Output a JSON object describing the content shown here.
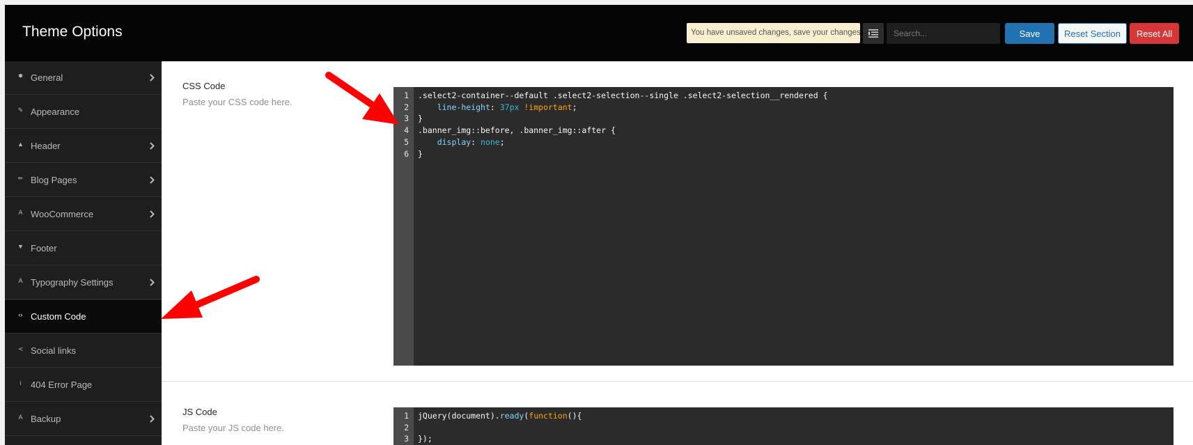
{
  "header": {
    "title": "Theme Options",
    "notice": "You have unsaved changes, save your changes!",
    "search_placeholder": "Search...",
    "save_label": "Save",
    "reset_section_label": "Reset Section",
    "reset_all_label": "Reset All",
    "list_icon": "list-icon"
  },
  "sidebar": {
    "items": [
      {
        "label": "General",
        "icon": "gear-icon",
        "glyph": "✹",
        "has_chevron": true,
        "active": false
      },
      {
        "label": "Appearance",
        "icon": "brush-icon",
        "glyph": "✎",
        "has_chevron": false,
        "active": false
      },
      {
        "label": "Header",
        "icon": "caret-up-icon",
        "glyph": "▲",
        "has_chevron": true,
        "active": false
      },
      {
        "label": "Blog Pages",
        "icon": "pin-icon",
        "glyph": "✏",
        "has_chevron": true,
        "active": false
      },
      {
        "label": "WooCommerce",
        "icon": "font-icon",
        "glyph": "A",
        "has_chevron": true,
        "active": false
      },
      {
        "label": "Footer",
        "icon": "caret-down-icon",
        "glyph": "▼",
        "has_chevron": false,
        "active": false
      },
      {
        "label": "Typography Settings",
        "icon": "font-icon",
        "glyph": "A",
        "has_chevron": true,
        "active": false
      },
      {
        "label": "Custom Code",
        "icon": "code-icon",
        "glyph": "‹›",
        "has_chevron": false,
        "active": true
      },
      {
        "label": "Social links",
        "icon": "share-icon",
        "glyph": "≺",
        "has_chevron": false,
        "active": false
      },
      {
        "label": "404 Error Page",
        "icon": "info-icon",
        "glyph": "i",
        "has_chevron": false,
        "active": false
      },
      {
        "label": "Backup",
        "icon": "font-icon",
        "glyph": "A",
        "has_chevron": true,
        "active": false
      }
    ]
  },
  "css_section": {
    "title": "CSS Code",
    "description": "Paste your CSS code here.",
    "lines": [
      {
        "n": "1",
        "tokens": [
          {
            "t": ".select2-container--default .select2-selection--single .select2-selection__rendered {",
            "c": ""
          }
        ]
      },
      {
        "n": "2",
        "tokens": [
          {
            "t": "    ",
            "c": ""
          },
          {
            "t": "line-height",
            "c": "tk-prop"
          },
          {
            "t": ": ",
            "c": ""
          },
          {
            "t": "37px",
            "c": "tk-num"
          },
          {
            "t": " ",
            "c": ""
          },
          {
            "t": "!important",
            "c": "tk-imp"
          },
          {
            "t": ";",
            "c": ""
          }
        ]
      },
      {
        "n": "3",
        "tokens": [
          {
            "t": "}",
            "c": ""
          }
        ]
      },
      {
        "n": "4",
        "tokens": [
          {
            "t": ".banner_img::before, .banner_img::after {",
            "c": ""
          }
        ]
      },
      {
        "n": "5",
        "tokens": [
          {
            "t": "    ",
            "c": ""
          },
          {
            "t": "display",
            "c": "tk-prop"
          },
          {
            "t": ": ",
            "c": ""
          },
          {
            "t": "none",
            "c": "tk-val"
          },
          {
            "t": ";",
            "c": ""
          }
        ]
      },
      {
        "n": "6",
        "tokens": [
          {
            "t": "}",
            "c": ""
          }
        ]
      }
    ]
  },
  "js_section": {
    "title": "JS Code",
    "description": "Paste your JS code here.",
    "lines": [
      {
        "n": "1",
        "tokens": [
          {
            "t": "jQuery(document).",
            "c": ""
          },
          {
            "t": "ready",
            "c": "tk-fn"
          },
          {
            "t": "(",
            "c": ""
          },
          {
            "t": "function",
            "c": "tk-kw"
          },
          {
            "t": "(){",
            "c": ""
          }
        ]
      },
      {
        "n": "2",
        "tokens": [
          {
            "t": "",
            "c": ""
          }
        ]
      },
      {
        "n": "3",
        "tokens": [
          {
            "t": "});",
            "c": ""
          }
        ]
      }
    ]
  },
  "colors": {
    "accent": "#2271b1",
    "danger": "#d63638",
    "annotation": "#ff0000"
  }
}
